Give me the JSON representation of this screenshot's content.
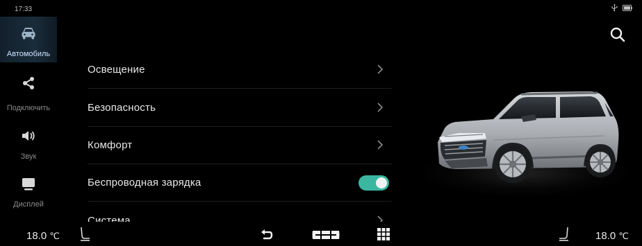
{
  "status": {
    "time": "17:33",
    "icons": [
      "usb-icon",
      "battery-icon"
    ]
  },
  "sidebar": {
    "items": [
      {
        "label": "Автомобиль",
        "icon": "car-icon",
        "active": true
      },
      {
        "label": "Подключить",
        "icon": "share-icon",
        "active": false
      },
      {
        "label": "Звук",
        "icon": "speaker-icon",
        "active": false
      },
      {
        "label": "Дисплей",
        "icon": "display-icon",
        "active": false
      }
    ]
  },
  "menu": {
    "items": [
      {
        "label": "Освещение",
        "control": "chevron"
      },
      {
        "label": "Безопасность",
        "control": "chevron"
      },
      {
        "label": "Комфорт",
        "control": "chevron"
      },
      {
        "label": "Беспроводная зарядка",
        "control": "toggle",
        "toggle_on": true
      },
      {
        "label": "Система",
        "control": "chevron"
      }
    ]
  },
  "search": {
    "icon": "search-icon"
  },
  "bottom_bar": {
    "left_temp": "18.0",
    "right_temp": "18.0",
    "unit": "℃",
    "icons": [
      "left-seat-heat-icon",
      "back-icon",
      "home-icon",
      "apps-grid-icon",
      "right-seat-heat-icon"
    ]
  },
  "colors": {
    "accent_toggle": "#3bb7a0",
    "active_item_bg": "#1a2c3a",
    "background": "#000000"
  }
}
